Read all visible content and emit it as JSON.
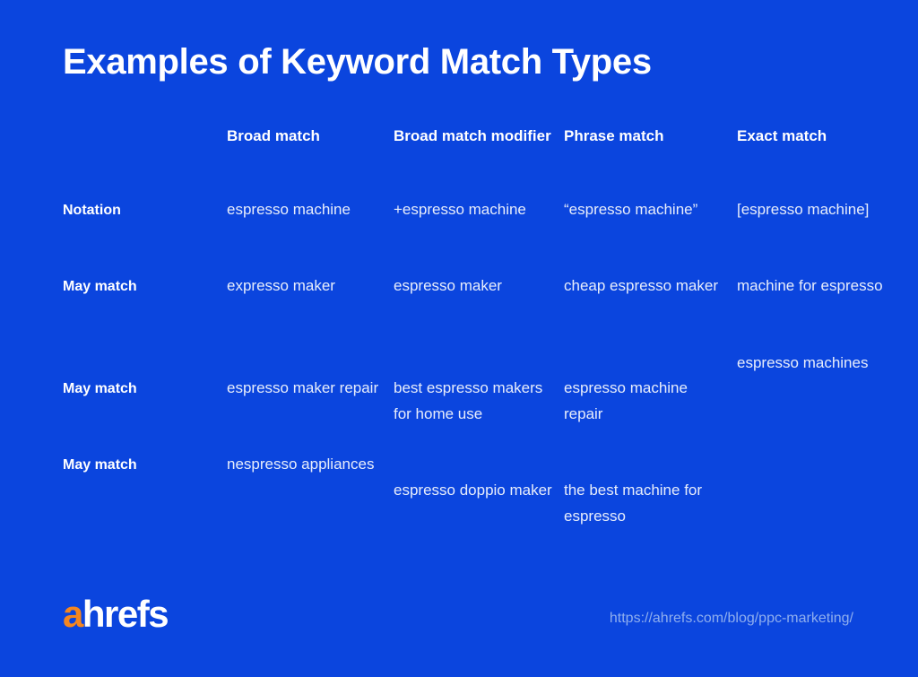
{
  "page": {
    "title": "Examples of Keyword Match Types",
    "background_color": "#0B45DE",
    "text_color": "#FFFFFF",
    "cell_text_color": "#E7EDFB"
  },
  "table": {
    "corner_label": "",
    "columns": [
      {
        "label": "Broad match"
      },
      {
        "label": "Broad match modifier"
      },
      {
        "label": "Phrase match"
      },
      {
        "label": "Exact match"
      }
    ],
    "row_labels": [
      "Notation",
      "May match",
      "May match",
      "May match"
    ],
    "cells": {
      "broad_match": [
        "espresso machine",
        "expresso maker",
        "espresso maker repair",
        "nespresso appliances"
      ],
      "broad_match_modifier": [
        "+espresso machine",
        "espresso maker",
        "best espresso makers for home use",
        "espresso doppio maker"
      ],
      "phrase_match": [
        "“espresso machine”",
        "cheap espresso maker",
        "espresso machine repair",
        "the best machine for espresso"
      ],
      "exact_match": [
        "[espresso machine]",
        "machine for espresso",
        "espresso machines"
      ]
    }
  },
  "footer": {
    "logo_a": "a",
    "logo_rest": "hrefs",
    "logo_accent_color": "#F5861F",
    "source_url": "https://ahrefs.com/blog/ppc-marketing/"
  }
}
